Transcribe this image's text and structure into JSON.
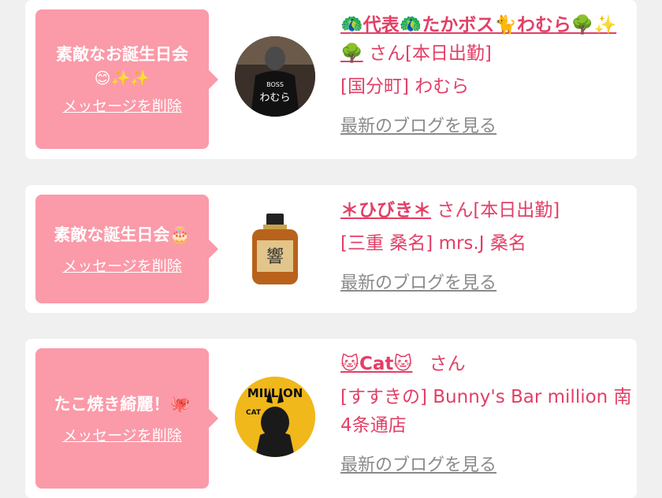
{
  "entries": [
    {
      "message_title": "素敵なお誕生日会",
      "message_emoji": "😊✨✨",
      "delete_label": "メッセージを削除",
      "cast_name": "🦚代表🦚たかボス🐈わむら🌳✨🌳",
      "san_label": "さん[本日出勤]",
      "shop_label": "[国分町] わむら",
      "blog_label": "最新のブログを見る",
      "avatar_text": "BOSS",
      "avatar_text2": "わむら"
    },
    {
      "message_title": "素敵な誕生日会🎂",
      "message_emoji": "",
      "delete_label": "メッセージを削除",
      "cast_name": "＊ひびき＊",
      "san_label": "さん[本日出勤]",
      "shop_label": "[三重 桑名] mrs.J 桑名",
      "blog_label": "最新のブログを見る",
      "avatar_text": "響",
      "avatar_text2": ""
    },
    {
      "message_title": "たこ焼き綺麗！🐙",
      "message_emoji": "",
      "delete_label": "メッセージを削除",
      "cast_name": "🐱Cat🐱",
      "san_label": "さん",
      "shop_label": "[すすきの] Bunny's Bar million 南4条通店",
      "blog_label": "最新のブログを見る",
      "avatar_text": "MILLION",
      "avatar_text2": "CAT"
    }
  ],
  "colors": {
    "accent": "#e23f66",
    "bubble": "#fb9aa9",
    "link_gray": "#8a8a8a",
    "background": "#f0f0f0"
  }
}
